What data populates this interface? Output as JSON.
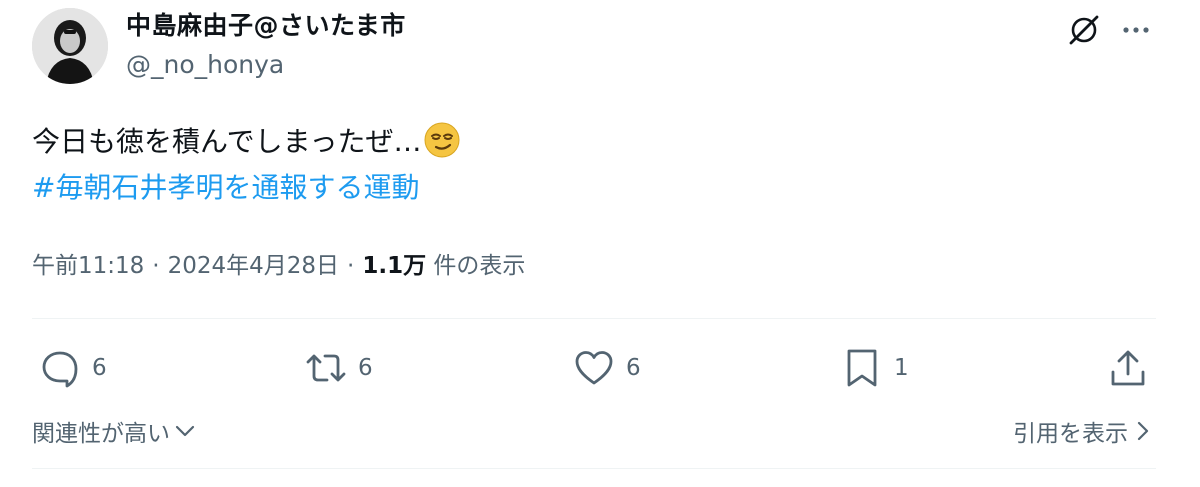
{
  "author": {
    "display_name": "中島麻由子@さいたま市",
    "handle": "@_no_honya"
  },
  "tweet": {
    "text": "今日も徳を積んでしまったぜ…",
    "emoji": "smirking-face",
    "hashtag": "#毎朝石井孝明を通報する運動"
  },
  "meta": {
    "time": "午前11:18",
    "separator": "·",
    "date": "2024年4月28日",
    "views_count": "1.1万",
    "views_label": "件の表示"
  },
  "actions": {
    "replies": "6",
    "retweets": "6",
    "likes": "6",
    "bookmarks": "1"
  },
  "footer": {
    "sort_label": "関連性が高い",
    "quotes_label": "引用を表示"
  },
  "colors": {
    "link": "#1d9bf0",
    "secondary_text": "#536471",
    "icon": "#536471",
    "divider": "#eff3f4"
  }
}
